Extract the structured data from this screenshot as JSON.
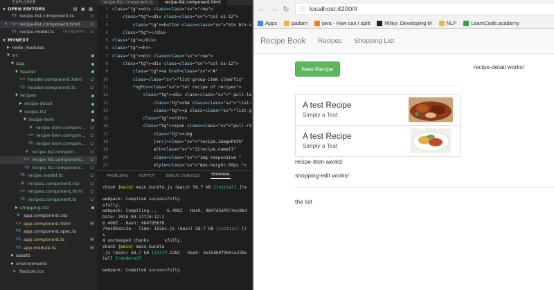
{
  "sidebar": {
    "title": "EXPLORER",
    "open_editors_label": "OPEN EDITORS",
    "open_editors": [
      {
        "name": "recipe-list.component.ts",
        "sub": "",
        "status": "U",
        "icon": "TS",
        "close": ""
      },
      {
        "name": "recipe-list.component.html",
        "sub": "",
        "status": "U",
        "icon": "<>",
        "close": "✕"
      },
      {
        "name": "recipe.model.ts",
        "sub": "src\\app\\reci...",
        "status": "U",
        "icon": "TS",
        "close": ""
      }
    ],
    "project_label": "MYNEXT",
    "tree": [
      {
        "name": "node_modules",
        "kind": "folder",
        "depth": 1,
        "open": false,
        "status": "",
        "color": ""
      },
      {
        "name": "src",
        "kind": "folder",
        "depth": 1,
        "open": true,
        "status": "dot",
        "color": "green"
      },
      {
        "name": "app",
        "kind": "folder",
        "depth": 2,
        "open": true,
        "status": "dot",
        "color": "green"
      },
      {
        "name": "header",
        "kind": "folder",
        "depth": 3,
        "open": true,
        "status": "dot",
        "color": "green"
      },
      {
        "name": "header.component.html",
        "kind": "html",
        "depth": 4,
        "status": "U",
        "color": "green"
      },
      {
        "name": "header.component.ts",
        "kind": "ts",
        "depth": 4,
        "status": "U",
        "color": "green"
      },
      {
        "name": "recipes",
        "kind": "folder",
        "depth": 3,
        "open": true,
        "status": "dot",
        "color": "green"
      },
      {
        "name": "recipe-detail",
        "kind": "folder",
        "depth": 4,
        "open": false,
        "status": "dot",
        "color": "green"
      },
      {
        "name": "recipe-list",
        "kind": "folder",
        "depth": 4,
        "open": true,
        "status": "dot",
        "color": "green"
      },
      {
        "name": "recipe-item",
        "kind": "folder",
        "depth": 5,
        "open": true,
        "status": "dot",
        "color": "green"
      },
      {
        "name": "recipe-item.compon...",
        "kind": "css",
        "depth": 6,
        "status": "U",
        "color": "green"
      },
      {
        "name": "recipe-item.compon...",
        "kind": "html",
        "depth": 6,
        "status": "U",
        "color": "green"
      },
      {
        "name": "recipe-item.compon...",
        "kind": "ts",
        "depth": 6,
        "status": "U",
        "color": "green"
      },
      {
        "name": "recipe-list.compon...",
        "kind": "css",
        "depth": 5,
        "status": "U",
        "color": "green"
      },
      {
        "name": "recipe-list.component...",
        "kind": "html",
        "depth": 5,
        "status": "U",
        "color": "green",
        "selected": true
      },
      {
        "name": "recipe-list.component...",
        "kind": "ts",
        "depth": 5,
        "status": "U",
        "color": "green"
      },
      {
        "name": "recipe.model.ts",
        "kind": "ts",
        "depth": 4,
        "status": "U",
        "color": "green"
      },
      {
        "name": "recipes.component.css",
        "kind": "css",
        "depth": 4,
        "status": "U",
        "color": "green"
      },
      {
        "name": "recipes.component.html",
        "kind": "html",
        "depth": 4,
        "status": "U",
        "color": "green"
      },
      {
        "name": "recipes.component.ts",
        "kind": "ts",
        "depth": 4,
        "status": "U",
        "color": "green"
      },
      {
        "name": "shopping-list",
        "kind": "folder",
        "depth": 3,
        "open": false,
        "status": "dot",
        "color": "green"
      },
      {
        "name": "app.component.css",
        "kind": "css",
        "depth": 3,
        "status": "",
        "color": ""
      },
      {
        "name": "app.component.html",
        "kind": "html",
        "depth": 3,
        "status": "M",
        "color": "yellow"
      },
      {
        "name": "app.component.spec.ts",
        "kind": "spec",
        "depth": 3,
        "status": "",
        "color": ""
      },
      {
        "name": "app.component.ts",
        "kind": "ts",
        "depth": 3,
        "status": "M",
        "color": "yellow"
      },
      {
        "name": "app.module.ts",
        "kind": "ts",
        "depth": 3,
        "status": "M",
        "color": "yellow"
      },
      {
        "name": "assets",
        "kind": "folder",
        "depth": 2,
        "open": false,
        "status": "",
        "color": ""
      },
      {
        "name": "environments",
        "kind": "folder",
        "depth": 2,
        "open": false,
        "status": "",
        "color": ""
      },
      {
        "name": "favicon.ico",
        "kind": "ico",
        "depth": 2,
        "status": "",
        "color": ""
      }
    ]
  },
  "editor": {
    "tabs": [
      "recipe-list.component.ts",
      "recipe-list.component.html"
    ],
    "active_tab": 1,
    "start_line": 1,
    "lines": [
      "<div class=\"row\">",
      "    <div class=\"col-xs-12\">",
      "        <button class=\"btn btn-success\">New Re",
      "    </div>",
      "</div>",
      "<hr>",
      "<div class=\"row\">",
      "    <div class=\"col-xs-12\">",
      "        <a href=\"#\"",
      "        class=\"list-group-item clearfix\"",
      "        *ngFor=\"let recipe of recipes\">",
      "            <div class=\" pull-left \">",
      "                <h4 class=\"list-group-item-hea",
      "                <p class=\"list-group-item-text",
      "            </div>",
      "            <span class=\"pull-right \">",
      "                <img",
      "                [src]=\"recipe.imagePath\"",
      "                alt=\"{{recipe.name}}\"",
      "                class=\"img-responsive \"",
      "                style=\"max-height:50px \">",
      "            </span>",
      "        </a>"
    ]
  },
  "panel": {
    "tabs": [
      "PROBLEMS",
      "OUTPUT",
      "DEBUG CONSOLE",
      "TERMINAL"
    ],
    "active_tab": 3,
    "terminal": [
      "chunk {main} main.bundle.js (main) 58.7 kB [initial] [re",
      "",
      "webpack: Compiled successfully.",
      "sfully.",
      "webpack: Compiling...    6.498Z - Hash: 9847d56f874e10bdc",
      "Date: 2018-04-17T18:12:2",
      "6.498Z - Hash: 9847d56f8",
      "74e10bdcc3a - Time: 155ms.js (main) 58.7 kB [initial] [re",
      "s",
      "4 unchanged chunks      sfully.",
      "chunk {main} main.bundle",
      ".js (main) 58.7 kB [init7.228Z - Hash: 3e15db0f90d1e22be",
      "ial] [rendered]",
      "",
      "webpack: Compiled successfully."
    ]
  },
  "browser": {
    "url": "localhost:4200/#",
    "bookmarks": [
      "Apps",
      "padam",
      "java - How can I split",
      "Wiley: Developing M",
      "NLP",
      "LearnCode.academy"
    ],
    "bookmark_colors": [
      "#4285f4",
      "#e8b84a",
      "#f48024",
      "#222222",
      "#e8b84a",
      "#3b9e4a"
    ]
  },
  "app": {
    "brand": "Recipe Book",
    "nav": [
      "Recipes",
      "Shopping List"
    ],
    "new_recipe_label": "New Recipe",
    "detail_text": "recipe-detail works!",
    "recipes": [
      {
        "name": "A test Recipe",
        "description": "Simply a Test"
      },
      {
        "name": "A test Recipe",
        "description": "Simply a Test"
      }
    ],
    "recipe_item_text": "recipe-item works!",
    "shopping_edit_text": "shopping-edit works!",
    "list_text": "the list"
  }
}
